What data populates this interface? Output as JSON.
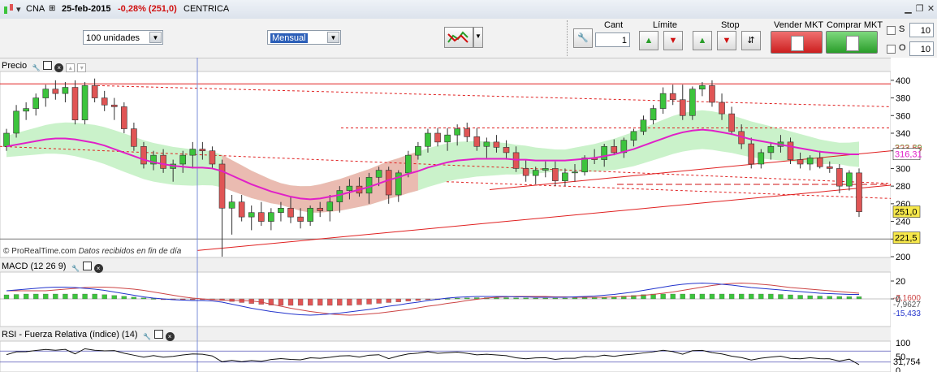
{
  "titlebar": {
    "symbol": "CNA",
    "date": "25-feb-2015",
    "change": "-0,28% (251,0)",
    "name": "CENTRICA"
  },
  "toolbar": {
    "units_select": "100 unidades",
    "period_select": "Mensual",
    "cant_label": "Cant",
    "cant_value": "1",
    "limite_label": "Límite",
    "stop_label": "Stop",
    "sell_label": "Vender MKT",
    "buy_label": "Comprar MKT",
    "s_label": "S",
    "s_value": "10",
    "o_label": "O",
    "o_value": "10"
  },
  "panels": {
    "price_title": "Precio",
    "macd_title": "MACD (12 26 9)",
    "rsi_title": "RSI - Fuerza Relativa (índice) (14)"
  },
  "watermark": {
    "brand": "© ProRealTime.com",
    "note": "Datos recibidos en fin de día"
  },
  "price_axis": {
    "ticks": [
      "400",
      "380",
      "360",
      "340",
      "320",
      "300",
      "280",
      "260",
      "240",
      "220",
      "200"
    ],
    "tags": {
      "upper_band": "323,56",
      "mid": "316,31",
      "last": "251,0",
      "low": "221,5",
      "band_top": "323,89"
    }
  },
  "macd_axis": {
    "ticks": [
      "20",
      "0"
    ],
    "tags": {
      "a": "-7,1600",
      "b": "-7,9627",
      "c": "-15,433"
    }
  },
  "rsi_axis": {
    "ticks": [
      "100",
      "50",
      "0"
    ],
    "tag": "31,754"
  },
  "colors": {
    "up": "#3cc43c",
    "down": "#e05555",
    "ma": "#e020c8",
    "red_line": "#e02020",
    "cloud_green": "#9ee89e",
    "cloud_red": "#f4a8a8",
    "macd_line": "#2233cc",
    "signal_line": "#cc4444"
  },
  "chart_data": {
    "type": "candlestick",
    "ylim": [
      200,
      410
    ],
    "candles": [
      [
        325,
        345,
        320,
        340
      ],
      [
        340,
        372,
        335,
        365
      ],
      [
        365,
        375,
        355,
        368
      ],
      [
        368,
        385,
        360,
        380
      ],
      [
        380,
        395,
        370,
        390
      ],
      [
        390,
        400,
        378,
        385
      ],
      [
        385,
        398,
        375,
        392
      ],
      [
        392,
        400,
        350,
        355
      ],
      [
        355,
        398,
        350,
        394
      ],
      [
        394,
        402,
        375,
        380
      ],
      [
        380,
        388,
        365,
        372
      ],
      [
        372,
        380,
        355,
        370
      ],
      [
        370,
        375,
        340,
        345
      ],
      [
        345,
        352,
        320,
        325
      ],
      [
        325,
        330,
        300,
        305
      ],
      [
        305,
        320,
        298,
        315
      ],
      [
        315,
        322,
        295,
        300
      ],
      [
        300,
        310,
        285,
        305
      ],
      [
        305,
        320,
        295,
        315
      ],
      [
        315,
        330,
        300,
        322
      ],
      [
        322,
        330,
        310,
        320
      ],
      [
        320,
        325,
        300,
        305
      ],
      [
        305,
        310,
        200,
        255
      ],
      [
        255,
        270,
        225,
        262
      ],
      [
        262,
        270,
        240,
        245
      ],
      [
        245,
        258,
        230,
        250
      ],
      [
        250,
        262,
        235,
        240
      ],
      [
        240,
        255,
        230,
        250
      ],
      [
        250,
        262,
        240,
        255
      ],
      [
        255,
        268,
        238,
        245
      ],
      [
        245,
        255,
        232,
        240
      ],
      [
        240,
        258,
        235,
        255
      ],
      [
        255,
        262,
        245,
        252
      ],
      [
        252,
        270,
        240,
        262
      ],
      [
        262,
        280,
        250,
        275
      ],
      [
        275,
        288,
        265,
        280
      ],
      [
        280,
        290,
        268,
        272
      ],
      [
        272,
        295,
        260,
        290
      ],
      [
        290,
        302,
        280,
        298
      ],
      [
        298,
        302,
        260,
        270
      ],
      [
        270,
        298,
        262,
        295
      ],
      [
        295,
        320,
        290,
        315
      ],
      [
        315,
        330,
        310,
        325
      ],
      [
        325,
        345,
        318,
        340
      ],
      [
        340,
        346,
        325,
        330
      ],
      [
        330,
        346,
        320,
        338
      ],
      [
        338,
        350,
        326,
        345
      ],
      [
        345,
        352,
        330,
        336
      ],
      [
        336,
        346,
        320,
        325
      ],
      [
        325,
        335,
        312,
        330
      ],
      [
        330,
        338,
        318,
        324
      ],
      [
        324,
        332,
        310,
        318
      ],
      [
        318,
        325,
        296,
        300
      ],
      [
        300,
        310,
        285,
        292
      ],
      [
        292,
        302,
        282,
        298
      ],
      [
        298,
        308,
        290,
        300
      ],
      [
        300,
        308,
        280,
        286
      ],
      [
        286,
        300,
        280,
        295
      ],
      [
        295,
        305,
        285,
        296
      ],
      [
        296,
        315,
        292,
        312
      ],
      [
        312,
        322,
        305,
        310
      ],
      [
        310,
        328,
        302,
        325
      ],
      [
        325,
        333,
        315,
        318
      ],
      [
        318,
        335,
        312,
        332
      ],
      [
        332,
        345,
        325,
        342
      ],
      [
        342,
        360,
        338,
        355
      ],
      [
        355,
        372,
        350,
        368
      ],
      [
        368,
        392,
        362,
        385
      ],
      [
        385,
        395,
        372,
        378
      ],
      [
        378,
        395,
        355,
        360
      ],
      [
        360,
        393,
        355,
        390
      ],
      [
        390,
        398,
        382,
        394
      ],
      [
        394,
        400,
        370,
        375
      ],
      [
        375,
        385,
        355,
        362
      ],
      [
        362,
        370,
        338,
        342
      ],
      [
        342,
        350,
        322,
        328
      ],
      [
        328,
        335,
        300,
        305
      ],
      [
        305,
        322,
        300,
        318
      ],
      [
        318,
        330,
        310,
        325
      ],
      [
        325,
        338,
        318,
        330
      ],
      [
        330,
        335,
        305,
        310
      ],
      [
        310,
        318,
        300,
        305
      ],
      [
        305,
        315,
        298,
        312
      ],
      [
        312,
        320,
        300,
        302
      ],
      [
        302,
        308,
        295,
        300
      ],
      [
        300,
        305,
        272,
        280
      ],
      [
        280,
        298,
        275,
        295
      ],
      [
        295,
        300,
        245,
        251
      ]
    ],
    "ma_values": [
      325,
      327,
      329,
      331,
      333,
      334,
      334,
      333,
      331,
      329,
      326,
      322,
      318,
      314,
      310,
      307,
      305,
      303,
      302,
      301,
      301,
      300,
      297,
      292,
      287,
      282,
      278,
      274,
      271,
      268,
      266,
      265,
      266,
      268,
      270,
      273,
      276,
      279,
      283,
      287,
      290,
      294,
      297,
      301,
      304,
      307,
      309,
      310,
      311,
      311,
      311,
      311,
      310,
      310,
      309,
      309,
      309,
      309,
      310,
      311,
      312,
      314,
      316,
      319,
      322,
      326,
      330,
      334,
      338,
      341,
      343,
      344,
      343,
      341,
      339,
      336,
      333,
      331,
      329,
      327,
      325,
      323,
      321,
      319,
      318,
      317,
      316,
      316
    ]
  }
}
